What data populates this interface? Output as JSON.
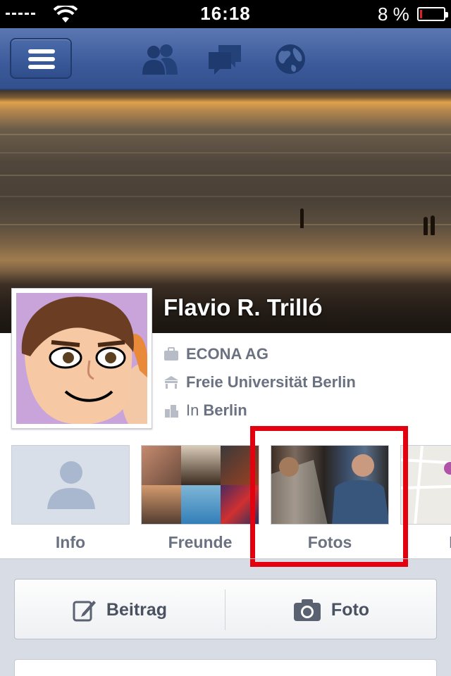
{
  "status_bar": {
    "time": "16:18",
    "battery_percent": "8 %",
    "battery_level": 0.08
  },
  "nav": {
    "menu_icon": "hamburger-icon",
    "icons": [
      "friend-requests-icon",
      "messages-icon",
      "notifications-globe-icon"
    ]
  },
  "profile": {
    "name": "Flavio R. Trilló",
    "work": "ECONA AG",
    "education": "Freie Universität Berlin",
    "location_prefix": "In",
    "location": "Berlin"
  },
  "tiles": [
    {
      "label": "Info"
    },
    {
      "label": "Freunde"
    },
    {
      "label": "Fotos"
    },
    {
      "label": "Ka"
    }
  ],
  "actions": {
    "post_label": "Beitrag",
    "photo_label": "Foto"
  },
  "colors": {
    "nav_blue": "#3c5a9a",
    "highlight_red": "#e3000f",
    "label_gray": "#6a7180"
  }
}
